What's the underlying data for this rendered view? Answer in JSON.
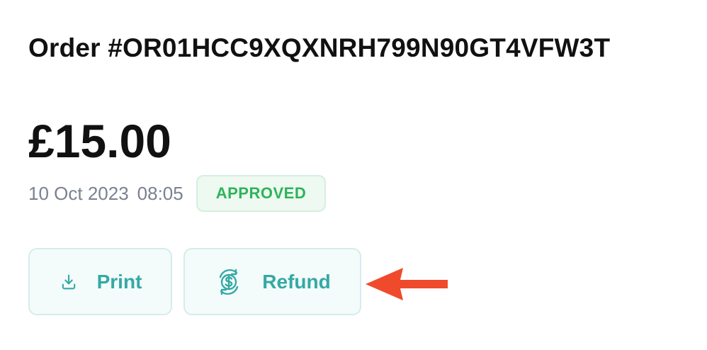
{
  "order": {
    "title": "Order #OR01HCC9XQXNRH799N90GT4VFW3T",
    "amount": "£15.00",
    "date": "10 Oct 2023",
    "time": "08:05",
    "status": "APPROVED"
  },
  "actions": {
    "print_label": "Print",
    "refund_label": "Refund"
  },
  "icons": {
    "print": "download-icon",
    "refund": "refund-dollar-icon",
    "annotation": "arrow-left-icon"
  },
  "colors": {
    "title_text": "#111111",
    "meta_text": "#7a8191",
    "approved_text": "#2fb35a",
    "approved_bg": "#edf9f1",
    "button_text": "#35a9a5",
    "button_bg": "#f3fbfb",
    "annotation_arrow": "#f04a2c"
  }
}
